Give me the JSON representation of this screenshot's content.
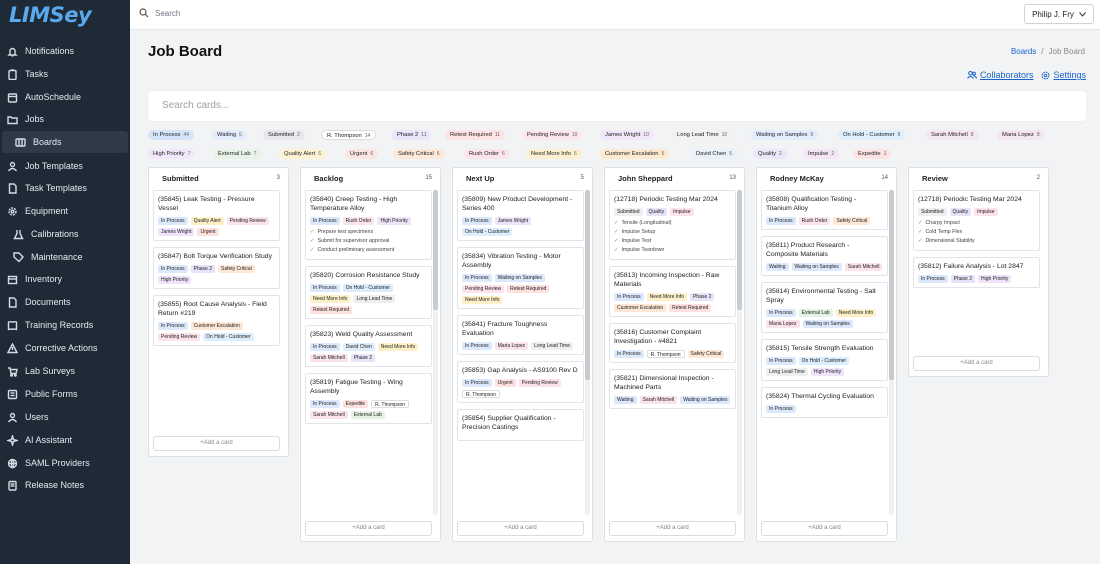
{
  "app": {
    "logo": "LIMSey"
  },
  "topbar": {
    "search_placeholder": "Search",
    "user": "Philip J. Fry"
  },
  "nav": [
    {
      "label": "Notifications",
      "icon": "bell-icon"
    },
    {
      "label": "Tasks",
      "icon": "clipboard-icon"
    },
    {
      "label": "AutoSchedule",
      "icon": "calendar-icon"
    },
    {
      "label": "Jobs",
      "icon": "folder-icon"
    },
    {
      "label": "Boards",
      "icon": "board-icon"
    },
    {
      "label": "Job Templates",
      "icon": "person-icon"
    },
    {
      "label": "Task Templates",
      "icon": "document-icon"
    },
    {
      "label": "Equipment",
      "icon": "gear-icon"
    },
    {
      "label": "Calibrations",
      "icon": "flask-icon"
    },
    {
      "label": "Maintenance",
      "icon": "tag-icon"
    },
    {
      "label": "Inventory",
      "icon": "box-icon"
    },
    {
      "label": "Documents",
      "icon": "document-icon"
    },
    {
      "label": "Training Records",
      "icon": "book-icon"
    },
    {
      "label": "Corrective Actions",
      "icon": "warning-icon"
    },
    {
      "label": "Lab Surveys",
      "icon": "cart-icon"
    },
    {
      "label": "Public Forms",
      "icon": "form-icon"
    },
    {
      "label": "Users",
      "icon": "user-icon"
    },
    {
      "label": "AI Assistant",
      "icon": "sparkle-icon"
    },
    {
      "label": "SAML Providers",
      "icon": "globe-icon"
    },
    {
      "label": "Release Notes",
      "icon": "notes-icon"
    }
  ],
  "page": {
    "title": "Job Board",
    "breadcrumb": [
      "Boards",
      "/",
      "Job Board"
    ],
    "collaborators": "Collaborators",
    "settings": "Settings",
    "card_search_placeholder": "Search cards..."
  },
  "filter_chips": [
    {
      "label": "In Process",
      "count": "44",
      "color": "#d6e4fb"
    },
    {
      "label": "Waiting",
      "count": "6",
      "color": "#e3ecfb"
    },
    {
      "label": "Submitted",
      "count": "2",
      "color": "#e6e8eb"
    },
    {
      "label": "R. Thompson",
      "count": "14",
      "color": "#ffffff"
    },
    {
      "label": "Phase 2",
      "count": "11",
      "color": "#e9e6fa"
    },
    {
      "label": "Retest Required",
      "count": "11",
      "color": "#fde3e3"
    },
    {
      "label": "Pending Review",
      "count": "10",
      "color": "#fbe7ef"
    },
    {
      "label": "James Wright",
      "count": "10",
      "color": "#f1e6fa"
    },
    {
      "label": "Long Lead Time",
      "count": "10",
      "color": "#f1f2f4"
    },
    {
      "label": "Waiting on Samples",
      "count": "9",
      "color": "#e3ecfb"
    },
    {
      "label": "On Hold - Customer",
      "count": "8",
      "color": "#deeefb"
    },
    {
      "label": "Sarah Mitchell",
      "count": "8",
      "color": "#f3e6f1"
    },
    {
      "label": "Maria Lopez",
      "count": "8",
      "color": "#f3e6f1"
    },
    {
      "label": "High Priority",
      "count": "7",
      "color": "#f1e7fa"
    },
    {
      "label": "External Lab",
      "count": "7",
      "color": "#e8f3e8"
    },
    {
      "label": "Quality Alert",
      "count": "6",
      "color": "#fdf3d4"
    },
    {
      "label": "Urgent",
      "count": "6",
      "color": "#fde6e2"
    },
    {
      "label": "Safety Critical",
      "count": "6",
      "color": "#fde8da"
    },
    {
      "label": "Rush Order",
      "count": "6",
      "color": "#fbe4ec"
    },
    {
      "label": "Need More Info",
      "count": "6",
      "color": "#fdf0d0"
    },
    {
      "label": "Customer Escalation",
      "count": "5",
      "color": "#fde9cf"
    },
    {
      "label": "David Chen",
      "count": "5",
      "color": "#eaf1fb"
    },
    {
      "label": "Quality",
      "count": "2",
      "color": "#ece6fa"
    },
    {
      "label": "Impulse",
      "count": "2",
      "color": "#f4e4f4"
    },
    {
      "label": "Expedite",
      "count": "1",
      "color": "#fde4e4"
    }
  ],
  "add_card_label": "+Add a card",
  "columns": [
    {
      "title": "Submitted",
      "count": "3",
      "cards": [
        {
          "title": "(35845) Leak Testing - Pressure Vessel",
          "tags": [
            [
              "In Process",
              "b"
            ],
            [
              "Quality Alert",
              "y"
            ],
            [
              "Pending Review",
              "p"
            ],
            [
              "James Wright",
              "v"
            ],
            [
              "Urgent",
              "r"
            ]
          ]
        },
        {
          "title": "(35847) Bolt Torque Verification Study",
          "tags": [
            [
              "In Process",
              "b"
            ],
            [
              "Phase 2",
              "l"
            ],
            [
              "Safety Critical",
              "o"
            ],
            [
              "High Priority",
              "v"
            ]
          ]
        },
        {
          "title": "(35855) Root Cause Analysis - Field Return #219",
          "tags": [
            [
              "In Process",
              "b"
            ],
            [
              "Customer Escalation",
              "o"
            ],
            [
              "Pending Review",
              "p"
            ],
            [
              "On Hold - Customer",
              "c"
            ]
          ]
        }
      ]
    },
    {
      "title": "Backlog",
      "count": "15",
      "cards": [
        {
          "title": "(35840) Creep Testing - High Temperature Alloy",
          "tags": [
            [
              "In Process",
              "b"
            ],
            [
              "Rush Order",
              "p"
            ],
            [
              "High Priority",
              "v"
            ]
          ],
          "checks": [
            "Prepare test specimens",
            "Submit for supervisor approval",
            "Conduct preliminary assessment"
          ]
        },
        {
          "title": "(35820) Corrosion Resistance Study",
          "tags": [
            [
              "In Process",
              "b"
            ],
            [
              "On Hold - Customer",
              "c"
            ],
            [
              "Need More Info",
              "y"
            ],
            [
              "Long Lead Time",
              "g"
            ],
            [
              "Retest Required",
              "r"
            ]
          ]
        },
        {
          "title": "(35823) Weld Quality Assessment",
          "tags": [
            [
              "In Process",
              "b"
            ],
            [
              "David Chen",
              "c"
            ],
            [
              "Need More Info",
              "y"
            ],
            [
              "Sarah Mitchell",
              "p"
            ],
            [
              "Phase 2",
              "l"
            ]
          ]
        },
        {
          "title": "(35819) Fatigue Testing - Wing Assembly",
          "tags": [
            [
              "In Process",
              "b"
            ],
            [
              "Expedite",
              "r"
            ],
            [
              "R. Thompson",
              "w"
            ],
            [
              "Sarah Mitchell",
              "p"
            ],
            [
              "External Lab",
              "e"
            ]
          ]
        }
      ]
    },
    {
      "title": "Next Up",
      "count": "5",
      "cards": [
        {
          "title": "(35809) New Product Development - Series 400",
          "tags": [
            [
              "In Process",
              "b"
            ],
            [
              "James Wright",
              "v"
            ],
            [
              "On Hold - Customer",
              "c"
            ]
          ]
        },
        {
          "title": "(35834) Vibration Testing - Motor Assembly",
          "tags": [
            [
              "In Process",
              "b"
            ],
            [
              "Waiting on Samples",
              "b"
            ],
            [
              "Pending Review",
              "p"
            ],
            [
              "Retest Required",
              "r"
            ],
            [
              "Need More Info",
              "y"
            ]
          ]
        },
        {
          "title": "(35841) Fracture Toughness Evaluation",
          "tags": [
            [
              "In Process",
              "b"
            ],
            [
              "Maria Lopez",
              "p"
            ],
            [
              "Long Lead Time",
              "g"
            ]
          ]
        },
        {
          "title": "(35853) Gap Analysis - AS9100 Rev D",
          "tags": [
            [
              "In Process",
              "b"
            ],
            [
              "Urgent",
              "r"
            ],
            [
              "Pending Review",
              "p"
            ],
            [
              "R. Thompson",
              "w"
            ]
          ]
        },
        {
          "title": "(35854) Supplier Qualification - Precision Castings",
          "tags": []
        }
      ]
    },
    {
      "title": "John Sheppard",
      "count": "13",
      "cards": [
        {
          "title": "(12718) Periodic Testing Mar 2024",
          "tags": [
            [
              "Submitted",
              "g"
            ],
            [
              "Quality",
              "l"
            ],
            [
              "Impulse",
              "p"
            ]
          ],
          "checks": [
            "Tensile (Longitudinal)",
            "Impulse Setup",
            "Impulse Test",
            "Impulse Teardown"
          ]
        },
        {
          "title": "(35813) Incoming Inspection - Raw Materials",
          "tags": [
            [
              "In Process",
              "b"
            ],
            [
              "Need More Info",
              "y"
            ],
            [
              "Phase 2",
              "l"
            ],
            [
              "Customer Escalation",
              "o"
            ],
            [
              "Retest Required",
              "r"
            ]
          ]
        },
        {
          "title": "(35816) Customer Complaint Investigation - #4821",
          "tags": [
            [
              "In Process",
              "b"
            ],
            [
              "R. Thompson",
              "w"
            ],
            [
              "Safety Critical",
              "o"
            ]
          ]
        },
        {
          "title": "(35821) Dimensional Inspection - Machined Parts",
          "tags": [
            [
              "Waiting",
              "b"
            ],
            [
              "Sarah Mitchell",
              "p"
            ],
            [
              "Waiting on Samples",
              "b"
            ]
          ]
        }
      ]
    },
    {
      "title": "Rodney McKay",
      "count": "14",
      "cards": [
        {
          "title": "(35808) Qualification Testing - Titanium Alloy",
          "tags": [
            [
              "In Process",
              "b"
            ],
            [
              "Rush Order",
              "p"
            ],
            [
              "Safety Critical",
              "o"
            ]
          ]
        },
        {
          "title": "(35811) Product Research - Composite Materials",
          "tags": [
            [
              "Waiting",
              "b"
            ],
            [
              "Waiting on Samples",
              "b"
            ],
            [
              "Sarah Mitchell",
              "p"
            ]
          ]
        },
        {
          "title": "(35814) Environmental Testing - Salt Spray",
          "tags": [
            [
              "In Process",
              "b"
            ],
            [
              "External Lab",
              "e"
            ],
            [
              "Need More Info",
              "y"
            ],
            [
              "Maria Lopez",
              "p"
            ],
            [
              "Waiting on Samples",
              "b"
            ]
          ]
        },
        {
          "title": "(35815) Tensile Strength Evaluation",
          "tags": [
            [
              "In Process",
              "b"
            ],
            [
              "On Hold - Customer",
              "c"
            ],
            [
              "Long Lead Time",
              "g"
            ],
            [
              "High Priority",
              "v"
            ]
          ]
        },
        {
          "title": "(35824) Thermal Cycling Evaluation",
          "tags": [
            [
              "In Process",
              "b"
            ]
          ]
        }
      ]
    },
    {
      "title": "Review",
      "count": "2",
      "cards": [
        {
          "title": "(12718) Periodic Testing Mar 2024",
          "tags": [
            [
              "Submitted",
              "g"
            ],
            [
              "Quality",
              "l"
            ],
            [
              "Impulse",
              "p"
            ]
          ],
          "checks": [
            "Charpy Impact",
            "Cold Temp Flex",
            "Dimensional Stability"
          ]
        },
        {
          "title": "(35812) Failure Analysis - Lot 2847",
          "tags": [
            [
              "In Process",
              "b"
            ],
            [
              "Phase 2",
              "l"
            ],
            [
              "High Priority",
              "v"
            ]
          ]
        }
      ]
    }
  ],
  "tag_colors": {
    "b": "#dce8fb",
    "y": "#fdf0c8",
    "p": "#fbe3ec",
    "v": "#efe3fa",
    "r": "#fde1df",
    "l": "#e7e4fa",
    "o": "#fde7d6",
    "c": "#dcedfb",
    "g": "#eceef0",
    "w": "#ffffff",
    "e": "#e4f3e4"
  }
}
